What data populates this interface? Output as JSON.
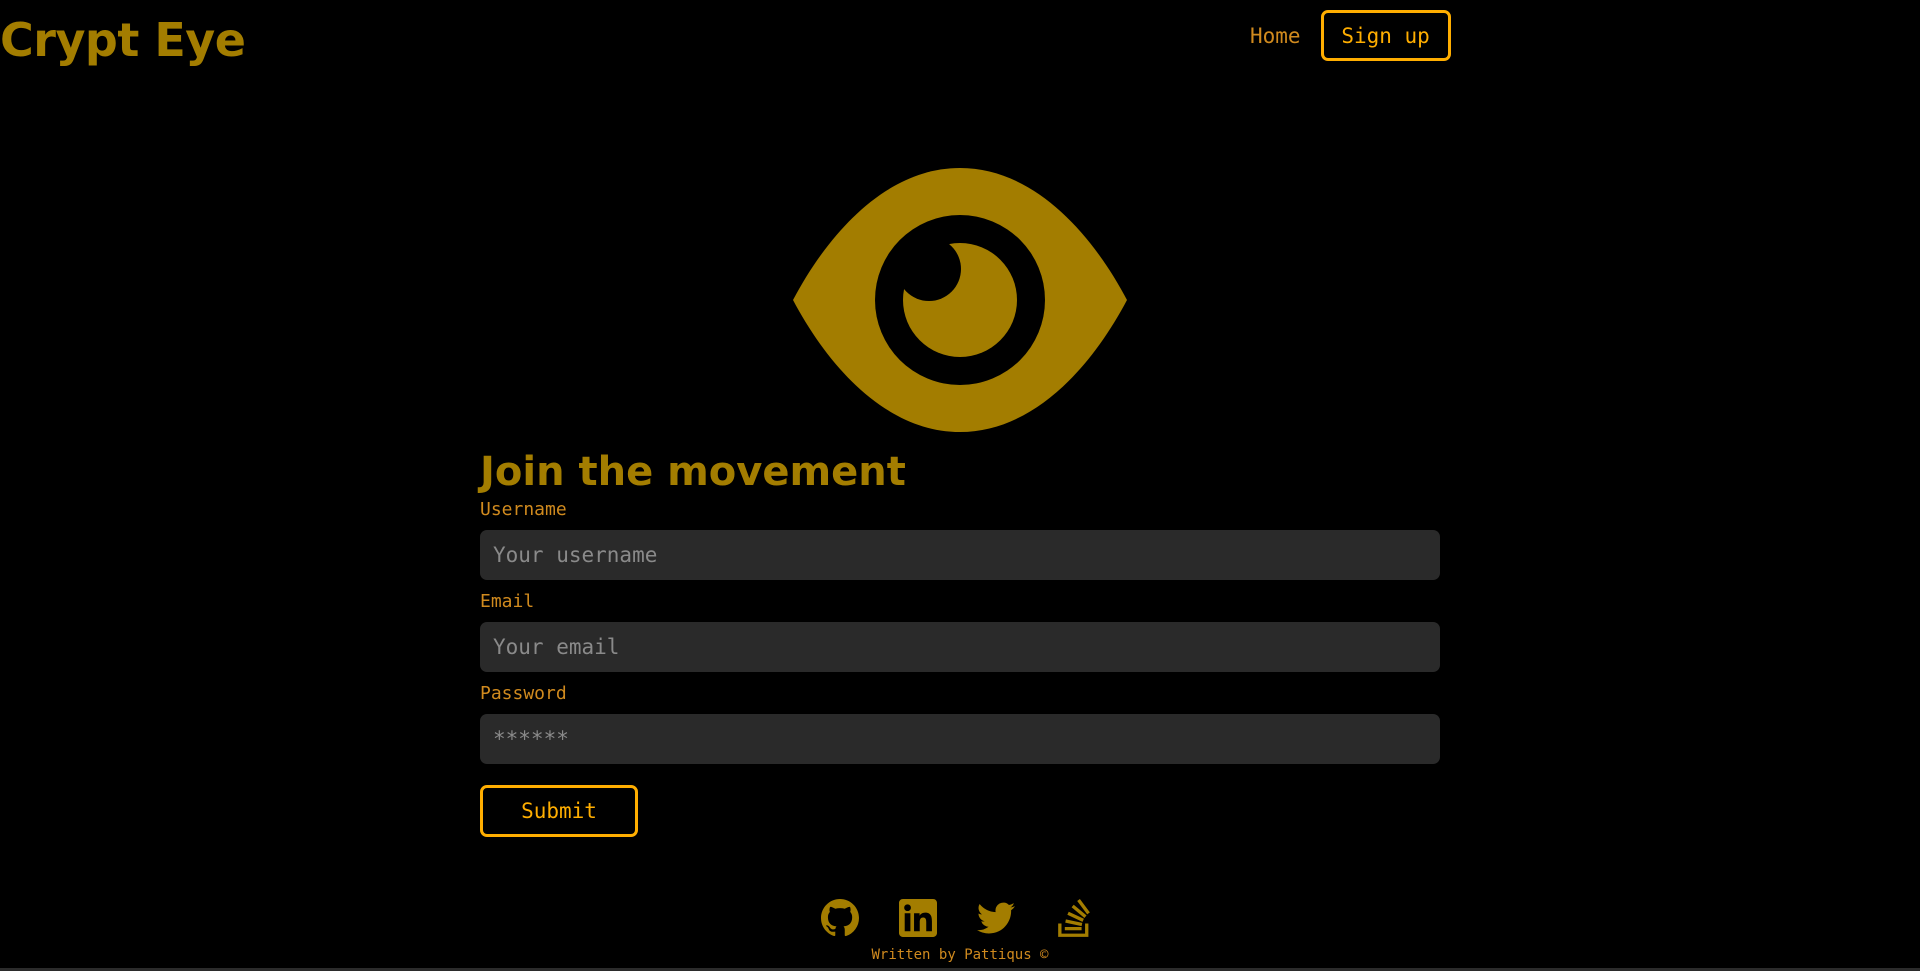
{
  "header": {
    "brand": "Crypt Eye",
    "nav": {
      "home_label": "Home",
      "signup_label": "Sign up"
    }
  },
  "hero": {
    "icon": "eye-icon"
  },
  "form": {
    "title": "Join the movement",
    "username": {
      "label": "Username",
      "placeholder": "Your username",
      "value": ""
    },
    "email": {
      "label": "Email",
      "placeholder": "Your email",
      "value": ""
    },
    "password": {
      "label": "Password",
      "placeholder": "******",
      "value": ""
    },
    "submit_label": "Submit"
  },
  "footer": {
    "social": [
      "github-icon",
      "linkedin-icon",
      "twitter-icon",
      "stackoverflow-icon"
    ],
    "credit": "Written by Pattiqus ©"
  },
  "colors": {
    "background": "#000000",
    "brand_gold": "#a37d00",
    "accent_orange": "#ffae00",
    "label_orange": "#d08a1e",
    "input_bg": "#2a2a2a"
  }
}
